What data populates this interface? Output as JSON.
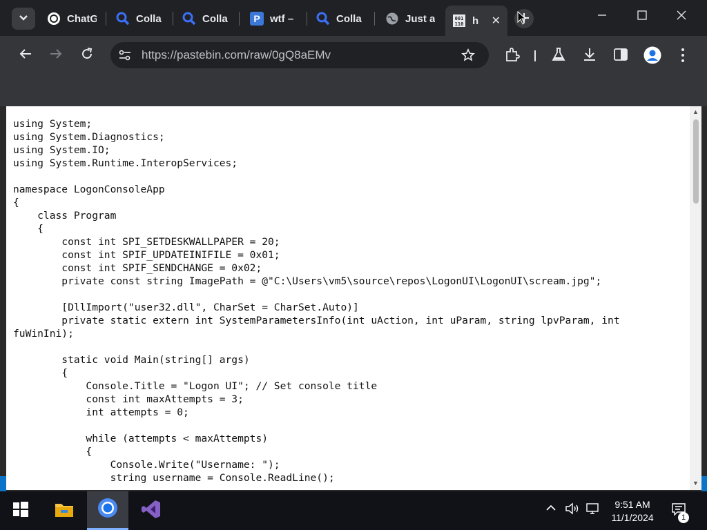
{
  "tabs": [
    {
      "title": "ChatG",
      "icon": "chatgpt-icon"
    },
    {
      "title": "Colla",
      "icon": "search-icon"
    },
    {
      "title": "Colla",
      "icon": "search-icon"
    },
    {
      "title": "wtf –",
      "icon": "pastebin-icon"
    },
    {
      "title": "Colla",
      "icon": "search-icon"
    },
    {
      "title": "Just a",
      "icon": "globe-icon"
    },
    {
      "title": "h",
      "icon": "binary-file-icon",
      "active": true
    }
  ],
  "tab_close": "✕",
  "address_bar": {
    "url": "https://pastebin.com/raw/0gQ8aEMv"
  },
  "code_text": "using System;\nusing System.Diagnostics;\nusing System.IO;\nusing System.Runtime.InteropServices;\n\nnamespace LogonConsoleApp\n{\n    class Program\n    {\n        const int SPI_SETDESKWALLPAPER = 20;\n        const int SPIF_UPDATEINIFILE = 0x01;\n        const int SPIF_SENDCHANGE = 0x02;\n        private const string ImagePath = @\"C:\\Users\\vm5\\source\\repos\\LogonUI\\LogonUI\\scream.jpg\";\n\n        [DllImport(\"user32.dll\", CharSet = CharSet.Auto)]\n        private static extern int SystemParametersInfo(int uAction, int uParam, string lpvParam, int\nfuWinIni);\n\n        static void Main(string[] args)\n        {\n            Console.Title = \"Logon UI\"; // Set console title\n            const int maxAttempts = 3;\n            int attempts = 0;\n\n            while (attempts < maxAttempts)\n            {\n                Console.Write(\"Username: \");\n                string username = Console.ReadLine();",
  "taskbar": {
    "time": "9:51 AM",
    "date": "11/1/2024",
    "notification_count": "1"
  }
}
